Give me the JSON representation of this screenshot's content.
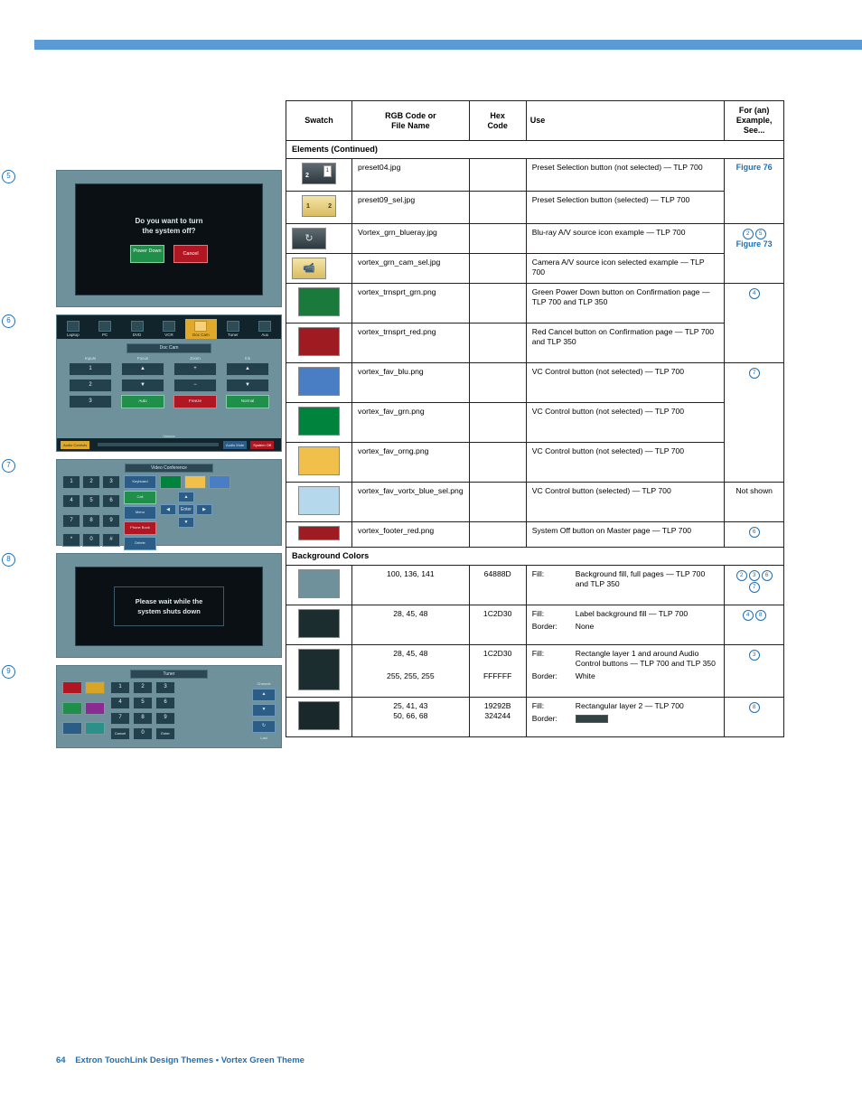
{
  "page": {
    "footer_number": "64",
    "footer_text": "Extron TouchLink Design Themes • Vortex Green Theme"
  },
  "table": {
    "headers": {
      "swatch": "Swatch",
      "rgb": "RGB Code or\nFile Name",
      "rgb_line1": "RGB Code or",
      "rgb_line2": "File Name",
      "hex_line1": "Hex",
      "hex_line2": "Code",
      "use": "Use",
      "example_line1": "For (an)",
      "example_line2": "Example,",
      "example_line3": "See..."
    },
    "sections": [
      {
        "title": "Elements (Continued)"
      },
      {
        "title": "Background Colors"
      }
    ],
    "elements_rows": [
      {
        "swatch": "preset04-thumbnail",
        "name": "preset04.jpg",
        "use": "Preset Selection button (not selected) — TLP  700",
        "example": "Figure 76",
        "example_type": "link"
      },
      {
        "swatch": "preset09-selected-thumbnail",
        "name": "preset09_sel.jpg",
        "use": "Preset Selection button (selected) — TLP 700",
        "example": "",
        "example_type": "none"
      },
      {
        "swatch": "bluray-icon-thumbnail",
        "name": "Vortex_grn_blueray.jpg",
        "use": "Blu-ray A/V source icon example — TLP 700",
        "example": "Figure 73",
        "example_type": "link-with-circles",
        "circles": [
          "2",
          "5"
        ]
      },
      {
        "swatch": "camera-selected-icon-thumbnail",
        "name": "vortex_grn_cam_sel.jpg",
        "use": "Camera A/V source icon selected example — TLP 700",
        "example": "",
        "example_type": "none"
      },
      {
        "swatch": "green-solid",
        "swatch_color": "#1a7a3c",
        "name": "vortex_trnsprt_grn.png",
        "use": "Green Power Down button on Confirmation page — TLP 700 and TLP 350",
        "example": "4",
        "example_type": "circle"
      },
      {
        "swatch": "red-solid",
        "swatch_color": "#9e1b22",
        "name": "vortex_trnsprt_red.png",
        "use": "Red Cancel button on Confirmation page — TLP 700 and TLP 350",
        "example": "",
        "example_type": "none"
      },
      {
        "swatch": "blue-solid",
        "swatch_color": "#4a7ec4",
        "name": "vortex_fav_blu.png",
        "use": "VC Control button (not selected) — TLP 700",
        "example": "7",
        "example_type": "circle"
      },
      {
        "swatch": "green2-solid",
        "swatch_color": "#00843d",
        "name": "vortex_fav_grn.png",
        "use": "VC Control button (not selected) — TLP 700",
        "example": "",
        "example_type": "none"
      },
      {
        "swatch": "orange-solid",
        "swatch_color": "#f0c04a",
        "name": "vortex_fav_orng.png",
        "use": "VC Control button (not selected) — TLP 700",
        "example": "",
        "example_type": "none"
      },
      {
        "swatch": "lightblue-solid",
        "swatch_color": "#b6d8ec",
        "name": "vortex_fav_vortx_blue_sel.png",
        "use": "VC Control button (selected) — TLP 700",
        "example": "Not shown",
        "example_type": "text"
      },
      {
        "swatch": "red-footer-solid",
        "swatch_color": "#9e1b22",
        "name": "vortex_footer_red.png",
        "use": "System Off button on Master page — TLP 700",
        "example": "6",
        "example_type": "circle"
      }
    ],
    "background_rows": [
      {
        "swatch": "teal-solid",
        "swatch_color": "#6e919b",
        "rgb": "100, 136, 141",
        "hex": "64888D",
        "use_pairs": [
          {
            "label": "Fill:",
            "text": "Background fill, full pages — TLP 700 and TLP 350"
          }
        ],
        "example_type": "circles",
        "circles": [
          "2",
          "3",
          "6",
          "7"
        ]
      },
      {
        "swatch": "darkteal-solid",
        "swatch_color": "#1c2d30",
        "rgb": "28, 45, 48",
        "hex": "1C2D30",
        "use_pairs": [
          {
            "label": "Fill:",
            "text": "Label background fill — TLP 700"
          },
          {
            "label": "Border:",
            "text": "None"
          }
        ],
        "example_type": "circles",
        "circles": [
          "4",
          "8"
        ]
      },
      {
        "swatch": "darkteal2-solid",
        "swatch_color": "#1c2d30",
        "rgb": "28, 45, 48",
        "rgb2": "255, 255, 255",
        "hex": "1C2D30",
        "hex2": "FFFFFF",
        "use_pairs": [
          {
            "label": "Fill:",
            "text": "Rectangle layer 1 and around Audio Control buttons — TLP 700 and TLP 350"
          },
          {
            "label": "Border:",
            "text": "White"
          }
        ],
        "example_type": "circles",
        "circles": [
          "3"
        ]
      },
      {
        "swatch": "darkest-solid",
        "swatch_color": "#19292b",
        "rgb": "25, 41, 43",
        "rgb2": "50, 66, 68",
        "hex": "19292B",
        "hex2": "324244",
        "use_pairs": [
          {
            "label": "Fill:",
            "text": "Rectangular layer 2 — TLP 700"
          },
          {
            "label": "Border:",
            "text": "",
            "swatch": "#324244"
          }
        ],
        "example_type": "circles",
        "circles": [
          "8"
        ]
      }
    ]
  },
  "figures": [
    {
      "callout": "5",
      "name": "confirmation-page-figure",
      "prompt_line1": "Do you want to turn",
      "prompt_line2": "the system off?",
      "buttons": [
        "Power Down",
        "Cancel"
      ]
    },
    {
      "callout": "6",
      "name": "doc-cam-page-figure",
      "nav": [
        "Laptop",
        "PC",
        "DVD",
        "VCR",
        "Doc Cam",
        "Tuner",
        "Aux"
      ],
      "title": "Doc Cam",
      "columns": [
        "Inputs",
        "Focus",
        "Zoom",
        "Iris"
      ],
      "inputs": [
        "1",
        "2",
        "3"
      ],
      "focus": [
        "▲",
        "▼",
        "Auto"
      ],
      "zoom": [
        "+",
        "−",
        "Freeze"
      ],
      "iris": [
        "▲",
        "▼",
        "Normal"
      ],
      "footer_left": "Audio Controls",
      "footer_volume": "Volume",
      "footer_mute": "Audio Mute",
      "footer_off": "System Off"
    },
    {
      "callout": "7",
      "name": "video-conference-page-figure",
      "title": "Video Conference",
      "keys": [
        "1",
        "2",
        "3",
        "4",
        "5",
        "6",
        "7",
        "8",
        "9",
        "*",
        "0",
        "#"
      ],
      "mid_buttons": [
        "Keyboard",
        "Call",
        "Menu",
        "Phone Book",
        "Delete"
      ],
      "arrows": [
        "▲",
        "◀",
        "Enter",
        "▶",
        "▼"
      ]
    },
    {
      "callout": "8",
      "name": "shutdown-page-figure",
      "line1": "Please wait while the",
      "line2": "system shuts down"
    },
    {
      "callout": "9",
      "name": "tuner-page-figure",
      "title": "Tuner",
      "keys": [
        "1",
        "2",
        "3",
        "4",
        "5",
        "6",
        "7",
        "8",
        "9",
        "Cancel",
        "0",
        "Enter"
      ],
      "channel_label": "Channel",
      "last_label": "Last"
    }
  ]
}
